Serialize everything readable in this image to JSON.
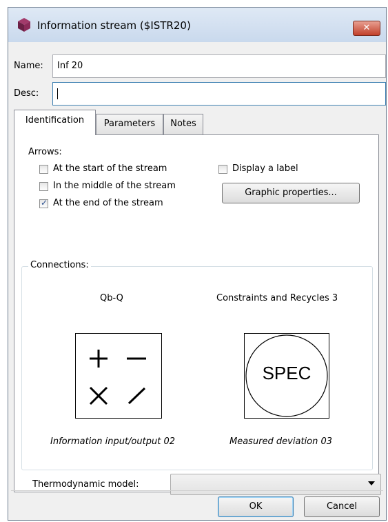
{
  "window": {
    "title": "Information stream ($ISTR20)",
    "close_label": "✕"
  },
  "name": {
    "label": "Name:",
    "value": "Inf 20"
  },
  "desc": {
    "label": "Desc:",
    "value": ""
  },
  "tabs": [
    {
      "label": "Identification",
      "active": true
    },
    {
      "label": "Parameters",
      "active": false
    },
    {
      "label": "Notes",
      "active": false
    }
  ],
  "arrows": {
    "label": "Arrows:",
    "options": [
      {
        "label": "At the start of the stream",
        "checked": false
      },
      {
        "label": "In the middle of the stream",
        "checked": false
      },
      {
        "label": "At the end of the stream",
        "checked": true
      }
    ]
  },
  "display_label": {
    "label": "Display a label",
    "checked": false
  },
  "graphic_properties_button": "Graphic properties...",
  "connections": {
    "label": "Connections:",
    "left": {
      "heading": "Qb-Q",
      "caption": "Information input/output 02",
      "symbols": [
        "+",
        "−",
        "×",
        "/"
      ]
    },
    "right": {
      "heading": "Constraints and Recycles 3",
      "caption": "Measured deviation 03",
      "symbol_text": "SPEC"
    }
  },
  "thermo": {
    "label": "Thermodynamic model:",
    "value": ""
  },
  "buttons": {
    "ok": "OK",
    "cancel": "Cancel"
  },
  "colors": {
    "title_bar": "#c9d9ed",
    "close": "#c2402a",
    "focus_border": "#3c7fb1",
    "check_mark": "#2a4f8f"
  },
  "icons": {
    "window": "cube-icon",
    "dropdown": "chevron-down-icon"
  }
}
